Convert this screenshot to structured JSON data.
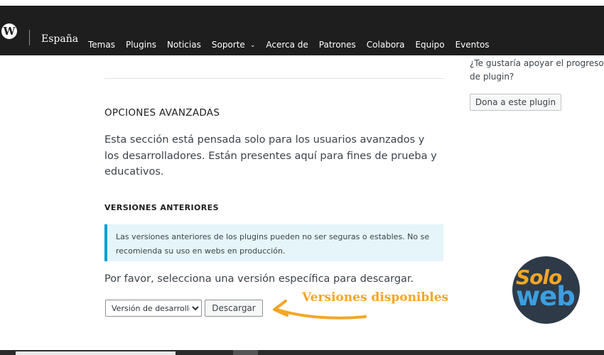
{
  "header": {
    "logo_glyph": "W",
    "locale": "España",
    "nav_items": [
      {
        "label": "Temas"
      },
      {
        "label": "Plugins"
      },
      {
        "label": "Noticias"
      },
      {
        "label": "Soporte",
        "has_dropdown": true
      },
      {
        "label": "Acerca de"
      },
      {
        "label": "Patrones"
      },
      {
        "label": "Colabora"
      },
      {
        "label": "Equipo"
      },
      {
        "label": "Eventos"
      }
    ]
  },
  "main": {
    "advanced_title": "OPCIONES AVANZADAS",
    "advanced_text": "Esta sección está pensada solo para los usuarios avanzados y los desarrolladores. Están presentes aquí para fines de prueba y educativos.",
    "versions_title": "VERSIONES ANTERIORES",
    "notice_text": "Las versiones anteriores de los plugins pueden no ser seguras o estables. No se recomienda su uso en webs en producción.",
    "select_prompt": "Por favor, selecciona una versión específica para descargar.",
    "version_selected": "Versión de desarrollo",
    "download_label": "Descargar"
  },
  "sidebar": {
    "support_text": "¿Te gustaría apoyar el progreso de plugin?",
    "donate_label": "Dona a este plugin"
  },
  "annotation": {
    "text": "Versiones disponibles",
    "color": "#f5a623"
  },
  "brand_logo": {
    "solo": "Solo",
    "web": "web"
  },
  "colors": {
    "nav_bg": "#1e1e1e",
    "notice_border": "#00a0d2",
    "notice_bg": "#e5f5fa",
    "logo_solo": "#f5a623",
    "logo_web": "#3b9fe0"
  }
}
